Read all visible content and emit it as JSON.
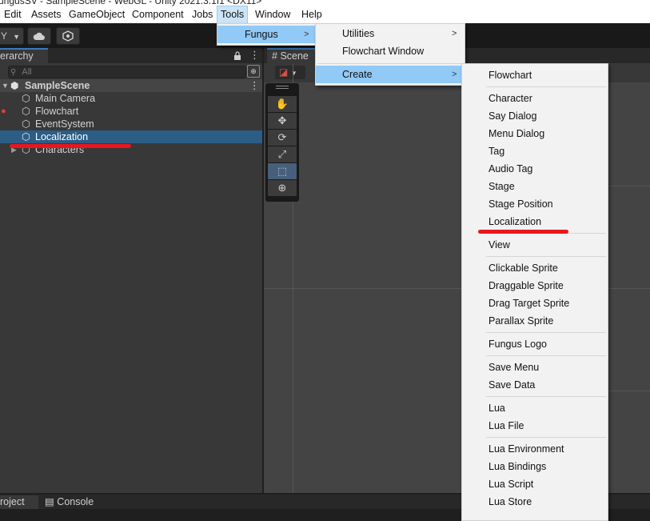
{
  "window_title": "ungusSV - SampleScene - WebGL - Unity 2021.3.1f1 <DX11>",
  "menubar": {
    "items": [
      "Edit",
      "Assets",
      "GameObject",
      "Component",
      "Jobs",
      "Tools",
      "Window",
      "Help"
    ]
  },
  "toolbar": {
    "account_label": "Y",
    "cloud_icon": "cloud-icon",
    "collab_icon": "collab-icon"
  },
  "hierarchy": {
    "tab_label": "erarchy",
    "search_placeholder": "All",
    "scene": "SampleScene",
    "items": [
      "Main Camera",
      "Flowchart",
      "EventSystem",
      "Localization",
      "Characters"
    ],
    "selected": "Localization"
  },
  "scene_view": {
    "tab_label": "Scene"
  },
  "bottom": {
    "project_tab": "roject",
    "console_tab": "Console"
  },
  "menus": {
    "tools": {
      "items": [
        "Fungus"
      ]
    },
    "fungus": {
      "items": [
        "Utilities",
        "Flowchart Window",
        "Create"
      ]
    },
    "create": {
      "groups": [
        [
          "Flowchart"
        ],
        [
          "Character",
          "Say Dialog",
          "Menu Dialog",
          "Tag",
          "Audio Tag",
          "Stage",
          "Stage Position",
          "Localization"
        ],
        [
          "View"
        ],
        [
          "Clickable Sprite",
          "Draggable Sprite",
          "Drag Target Sprite",
          "Parallax Sprite"
        ],
        [
          "Fungus Logo"
        ],
        [
          "Save Menu",
          "Save Data"
        ],
        [
          "Lua",
          "Lua File"
        ],
        [
          "Lua Environment",
          "Lua Bindings",
          "Lua Script",
          "Lua Store"
        ]
      ]
    }
  },
  "colors": {
    "highlight": "#91c9f7",
    "selection": "#2c5d87",
    "annotation": "#e8161d"
  }
}
